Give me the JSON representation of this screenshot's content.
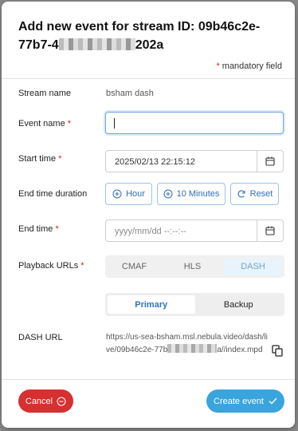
{
  "dialog": {
    "title": "Add new event for stream ID: 09b46c2e-77b7-4",
    "title_tail": "202a",
    "mandatory_note": "mandatory field",
    "required_marker": "*"
  },
  "form": {
    "stream_name": {
      "label": "Stream name",
      "value": "bsham dash"
    },
    "event_name": {
      "label": "Event name",
      "value": ""
    },
    "start_time": {
      "label": "Start time",
      "value": "2025/02/13 22:15:12"
    },
    "end_time_duration": {
      "label": "End time duration",
      "buttons": {
        "hour": "Hour",
        "ten_minutes": "10 Minutes",
        "reset": "Reset"
      }
    },
    "end_time": {
      "label": "End time",
      "placeholder": "yyyy/mm/dd --:--:--"
    },
    "playback_urls": {
      "label": "Playback URLs",
      "options": [
        "CMAF",
        "HLS",
        "DASH"
      ],
      "selected": "DASH"
    },
    "variant": {
      "options": [
        "Primary",
        "Backup"
      ],
      "selected": "Primary"
    },
    "dash_url": {
      "label": "DASH URL",
      "value_start": "https://us-sea-bsham.msl.nebula.video/dash/live/09b46c2e-77b",
      "value_end": "a//index.mpd"
    }
  },
  "footer": {
    "cancel_label": "Cancel",
    "create_label": "Create event"
  },
  "colors": {
    "cancel": "#d63031",
    "create": "#3aa4dc",
    "accent": "#2f74c0",
    "required": "#d42020"
  }
}
